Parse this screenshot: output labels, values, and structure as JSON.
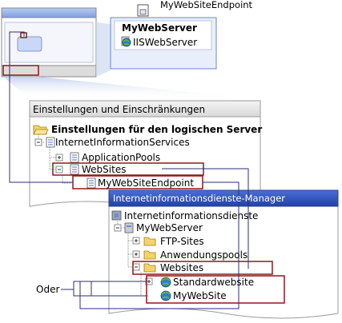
{
  "endpoint_callout": "MyWebSiteEndpoint",
  "server_box": {
    "title": "MyWebServer",
    "subtitle": "IISWebServer"
  },
  "settings_panel": {
    "header": "Einstellungen und Einschränkungen",
    "items": [
      "Einstellungen für den logischen Server",
      "InternetInformationServices",
      "ApplicationPools",
      "WebSites",
      "MyWebSiteEndpoint"
    ]
  },
  "iis_panel": {
    "header": "Internetinformationsdienste-Manager",
    "items": [
      "Internetinformationsdienste",
      "MyWebServer",
      "FTP-Sites",
      "Anwendungspools",
      "Websites",
      "Standardwebsite",
      "MyWebSite"
    ]
  },
  "oder_label": "Oder",
  "colors": {
    "highlight": "#8b1a1a",
    "connector": "#2e2e7a",
    "panel_header": "#3050b0",
    "callout_fill": "#e8eefb"
  }
}
